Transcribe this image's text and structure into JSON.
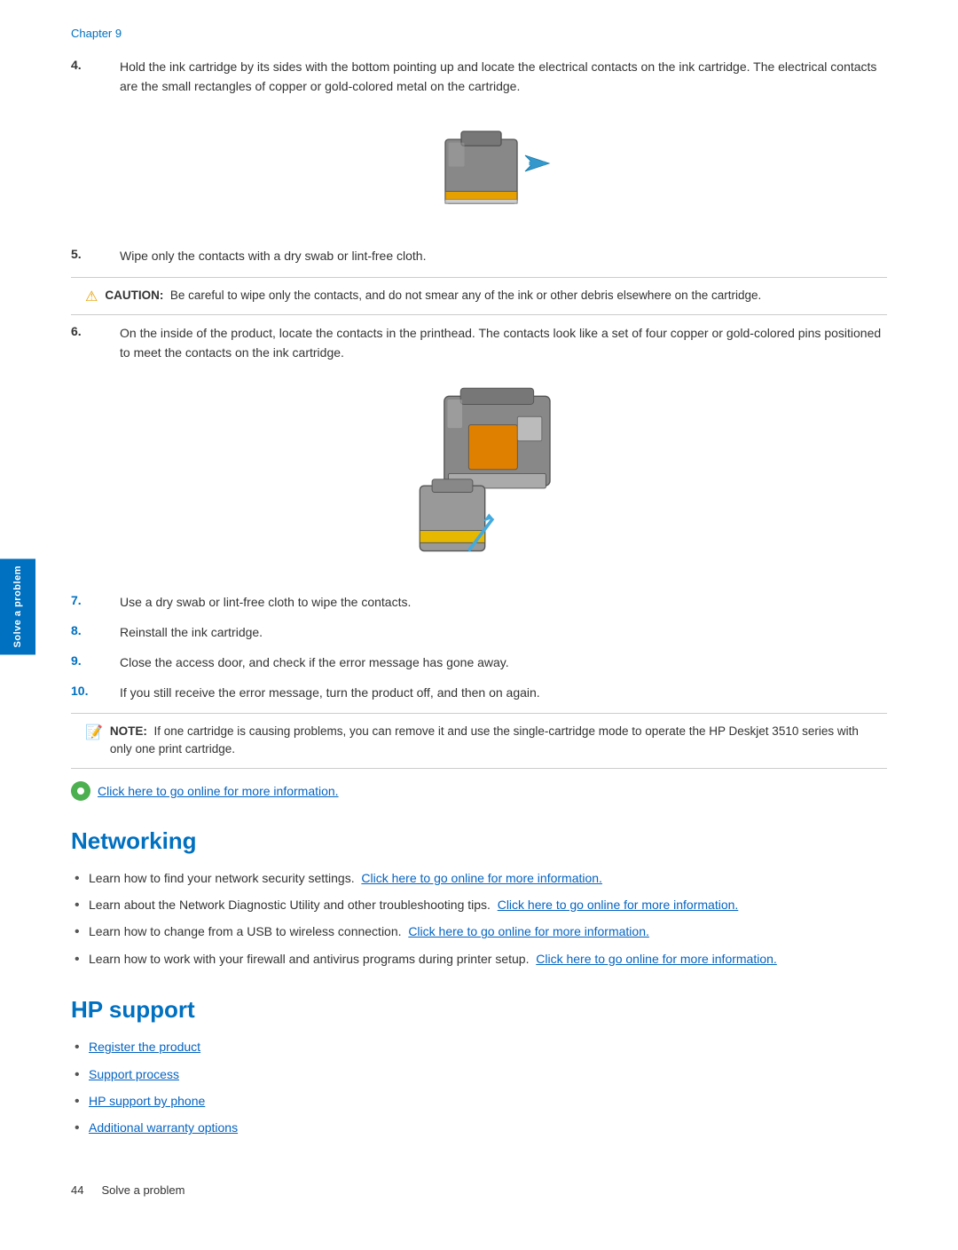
{
  "chapter": {
    "label": "Chapter 9"
  },
  "steps": [
    {
      "number": "4.",
      "colorClass": "normal",
      "text": "Hold the ink cartridge by its sides with the bottom pointing up and locate the electrical contacts on the ink cartridge. The electrical contacts are the small rectangles of copper or gold-colored metal on the cartridge."
    },
    {
      "number": "5.",
      "colorClass": "normal",
      "text": "Wipe only the contacts with a dry swab or lint-free cloth."
    },
    {
      "number": "6.",
      "colorClass": "normal",
      "text": "On the inside of the product, locate the contacts in the printhead. The contacts look like a set of four copper or gold-colored pins positioned to meet the contacts on the ink cartridge."
    },
    {
      "number": "7.",
      "colorClass": "blue",
      "text": "Use a dry swab or lint-free cloth to wipe the contacts."
    },
    {
      "number": "8.",
      "colorClass": "blue",
      "text": "Reinstall the ink cartridge."
    },
    {
      "number": "9.",
      "colorClass": "blue",
      "text": "Close the access door, and check if the error message has gone away."
    },
    {
      "number": "10.",
      "colorClass": "blue",
      "text": "If you still receive the error message, turn the product off, and then on again."
    }
  ],
  "caution": {
    "label": "CAUTION:",
    "text": "Be careful to wipe only the contacts, and do not smear any of the ink or other debris elsewhere on the cartridge."
  },
  "note": {
    "label": "NOTE:",
    "text": "If one cartridge is causing problems, you can remove it and use the single-cartridge mode to operate the HP Deskjet 3510 series with only one print cartridge."
  },
  "online_link": {
    "text": "Click here to go online for more information."
  },
  "networking": {
    "title": "Networking",
    "bullets": [
      {
        "text_before": "Learn how to find your network security settings.",
        "link_text": "Click here to go online for more information.",
        "text_after": ""
      },
      {
        "text_before": "Learn about the Network Diagnostic Utility and other troubleshooting tips.",
        "link_text": "Click here to go online for more information.",
        "text_after": ""
      },
      {
        "text_before": "Learn how to change from a USB to wireless connection.",
        "link_text": "Click here to go online for more information.",
        "text_after": ""
      },
      {
        "text_before": "Learn how to work with your firewall and antivirus programs during printer setup.",
        "link_text": "Click here to go online for more information.",
        "text_after": ""
      }
    ]
  },
  "hp_support": {
    "title": "HP support",
    "links": [
      "Register the product",
      "Support process",
      "HP support by phone",
      "Additional warranty options"
    ]
  },
  "footer": {
    "page_number": "44",
    "label": "Solve a problem"
  },
  "sidebar": {
    "label": "Solve a problem"
  }
}
